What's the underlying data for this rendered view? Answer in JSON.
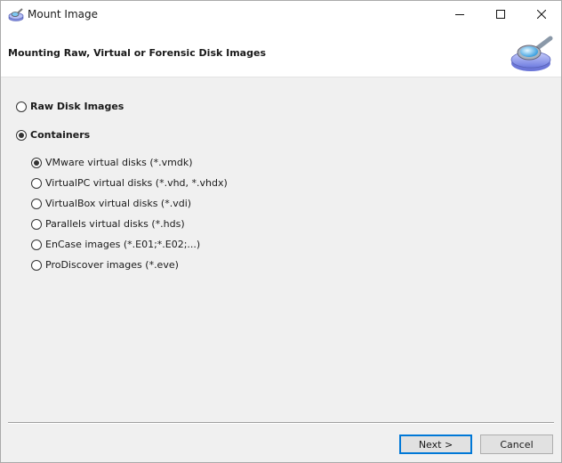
{
  "window": {
    "title": "Mount Image",
    "controls": {
      "minimize": "minimize-icon",
      "maximize": "maximize-icon",
      "close": "close-icon"
    }
  },
  "header": {
    "title": "Mounting Raw, Virtual or Forensic Disk Images",
    "icon": "disk-magnifier-icon"
  },
  "options": {
    "raw": {
      "label": "Raw Disk Images",
      "selected": false
    },
    "containers": {
      "label": "Containers",
      "selected": true
    }
  },
  "container_types": [
    {
      "label": "VMware virtual disks (*.vmdk)",
      "selected": true
    },
    {
      "label": "VirtualPC virtual disks (*.vhd, *.vhdx)",
      "selected": false
    },
    {
      "label": "VirtualBox virtual disks (*.vdi)",
      "selected": false
    },
    {
      "label": "Parallels virtual disks (*.hds)",
      "selected": false
    },
    {
      "label": "EnCase images (*.E01;*.E02;...)",
      "selected": false
    },
    {
      "label": "ProDiscover images (*.eve)",
      "selected": false
    }
  ],
  "buttons": {
    "next": "Next >",
    "cancel": "Cancel"
  },
  "colors": {
    "focus_border": "#0078d7"
  }
}
